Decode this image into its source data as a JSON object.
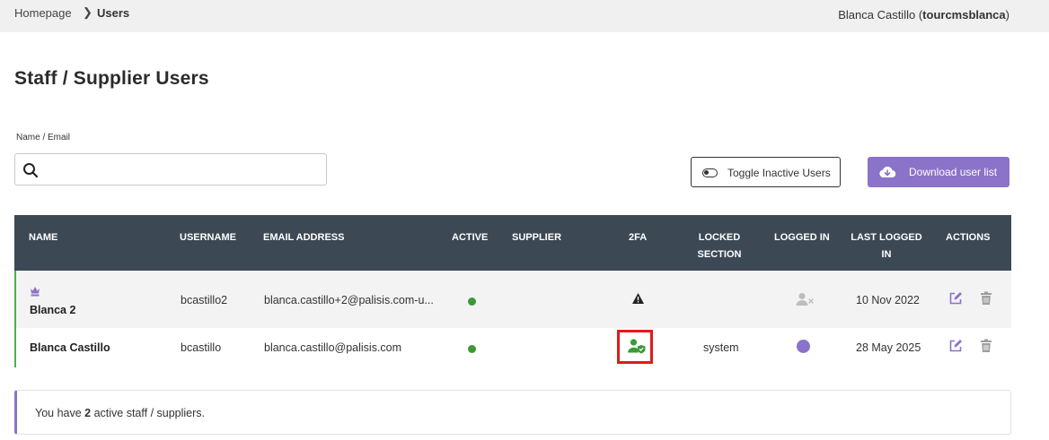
{
  "breadcrumb": {
    "home": "Homepage",
    "separator": "❯",
    "current": "Users"
  },
  "user": {
    "name": "Blanca Castillo",
    "username": "tourcmsblanca"
  },
  "page": {
    "title": "Staff / Supplier Users"
  },
  "search": {
    "label": "Name / Email",
    "value": "",
    "placeholder": ""
  },
  "toolbar": {
    "toggle_label": "Toggle Inactive Users",
    "download_label": "Download user list"
  },
  "table": {
    "headers": {
      "name": "NAME",
      "username": "USERNAME",
      "email": "EMAIL ADDRESS",
      "active": "ACTIVE",
      "supplier": "SUPPLIER",
      "twofa": "2FA",
      "locked_1": "LOCKED",
      "locked_2": "SECTION",
      "logged_in": "LOGGED IN",
      "last_logged_1": "LAST LOGGED",
      "last_logged_2": "IN",
      "actions": "ACTIONS"
    },
    "rows": [
      {
        "name": "Blanca 2",
        "role_icon": "crown-icon",
        "username": "bcastillo2",
        "email": "blanca.castillo+2@palisis.com-u...",
        "active": true,
        "supplier": "",
        "twofa_icon": "warning-icon",
        "locked_section": "",
        "logged_in_icon": "user-logged-out-icon",
        "last_logged_in": "10 Nov 2022"
      },
      {
        "name": "Blanca Castillo",
        "username": "bcastillo",
        "email": "blanca.castillo@palisis.com",
        "active": true,
        "supplier": "",
        "twofa_icon": "user-shield-icon",
        "locked_section": "system",
        "logged_in_icon": "online-dot",
        "last_logged_in": "28 May 2025"
      }
    ]
  },
  "summary": {
    "prefix": "You have ",
    "count": "2",
    "suffix": " active staff / suppliers."
  },
  "colors": {
    "accent": "#8b73c9",
    "header_bg": "#3c4854",
    "active_green": "#3a9a36",
    "twofa_green": "#3a9a36",
    "highlight_red": "#e01b1b"
  }
}
